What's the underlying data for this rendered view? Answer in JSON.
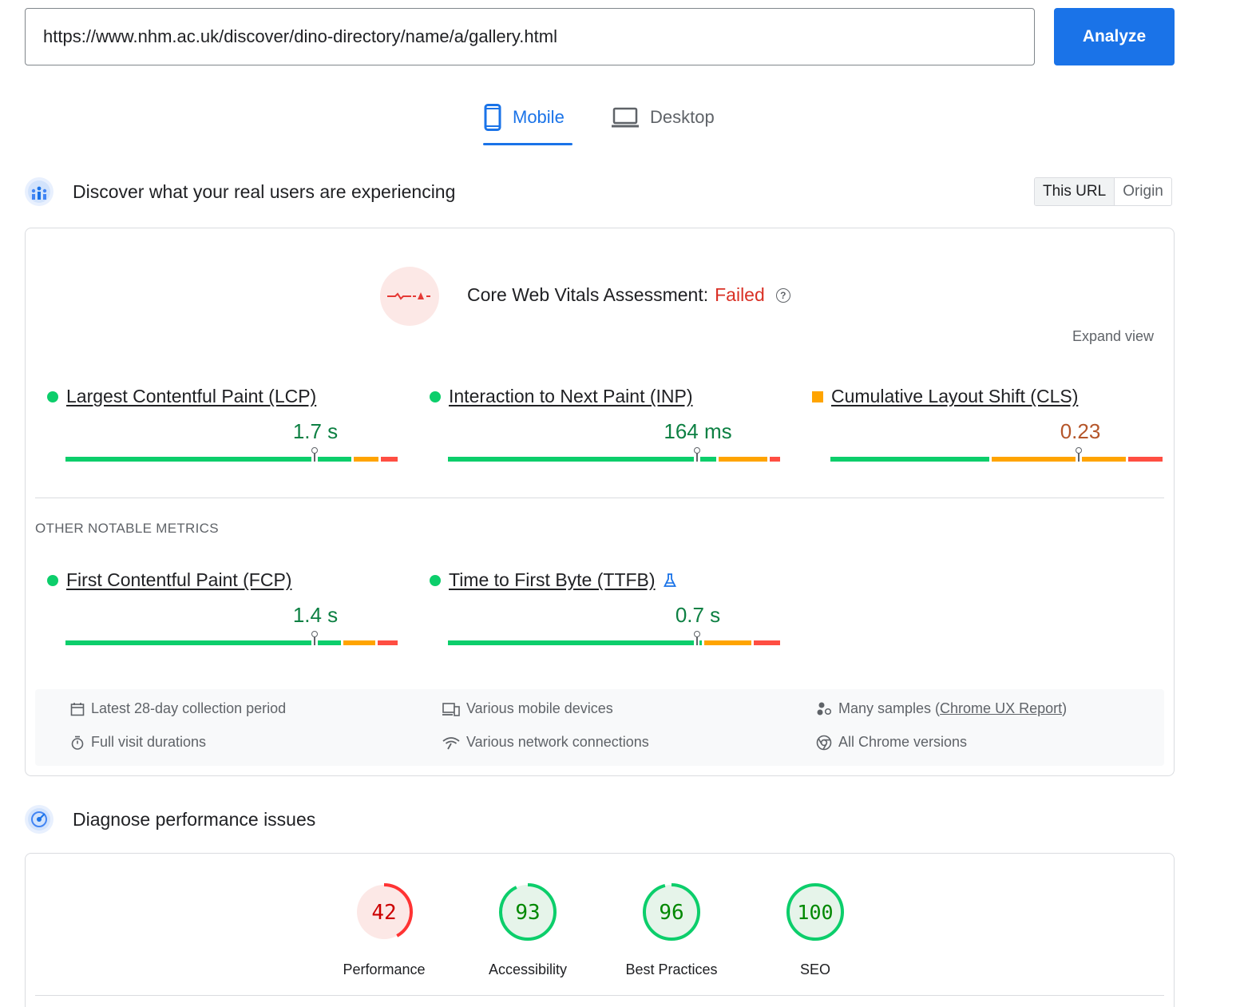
{
  "search": {
    "url": "https://www.nhm.ac.uk/discover/dino-directory/name/a/gallery.html",
    "analyze_label": "Analyze"
  },
  "tabs": {
    "mobile": "Mobile",
    "desktop": "Desktop"
  },
  "field": {
    "title": "Discover what your real users are experiencing",
    "toggle": {
      "this_url": "This URL",
      "origin": "Origin"
    },
    "assessment_label": "Core Web Vitals Assessment:",
    "assessment_status": "Failed",
    "status_color": "#d93025",
    "expand_view": "Expand view",
    "core_metrics": [
      {
        "name": "Largest Contentful Paint (LCP)",
        "value": "1.7 s",
        "rating": "good",
        "distribution": [
          75,
          10,
          8,
          7
        ],
        "marker_fraction": 0.75
      },
      {
        "name": "Interaction to Next Paint (INP)",
        "value": "164 ms",
        "rating": "good",
        "distribution": [
          75,
          5,
          15,
          5
        ],
        "marker_fraction": 0.75
      },
      {
        "name": "Cumulative Layout Shift (CLS)",
        "value": "0.23",
        "rating": "needs-improvement",
        "distribution": [
          48,
          43,
          9
        ],
        "marker_fraction": 0.75
      }
    ],
    "other_label": "OTHER NOTABLE METRICS",
    "other_metrics": [
      {
        "name": "First Contentful Paint (FCP)",
        "value": "1.4 s",
        "rating": "good",
        "marker_fraction": 0.75
      },
      {
        "name": "Time to First Byte (TTFB)",
        "value": "0.7 s",
        "rating": "good",
        "experimental": true,
        "marker_fraction": 0.75
      }
    ],
    "info": {
      "collection_period": "Latest 28-day collection period",
      "devices": "Various mobile devices",
      "samples_prefix": "Many samples (",
      "samples_link": "Chrome UX Report",
      "samples_suffix": ")",
      "visit_durations": "Full visit durations",
      "network": "Various network connections",
      "chrome_versions": "All Chrome versions"
    }
  },
  "lab": {
    "title": "Diagnose performance issues",
    "scores": [
      {
        "label": "Performance",
        "score": "42",
        "value": 42,
        "color": "#ff3333",
        "text_color": "#c00",
        "bg": "#fce8e6"
      },
      {
        "label": "Accessibility",
        "score": "93",
        "value": 93,
        "color": "#0cce6b",
        "text_color": "#080",
        "bg": "#e6f4ea"
      },
      {
        "label": "Best Practices",
        "score": "96",
        "value": 96,
        "color": "#0cce6b",
        "text_color": "#080",
        "bg": "#e6f4ea"
      },
      {
        "label": "SEO",
        "score": "100",
        "value": 100,
        "color": "#0cce6b",
        "text_color": "#080",
        "bg": "#e6f4ea"
      }
    ]
  }
}
